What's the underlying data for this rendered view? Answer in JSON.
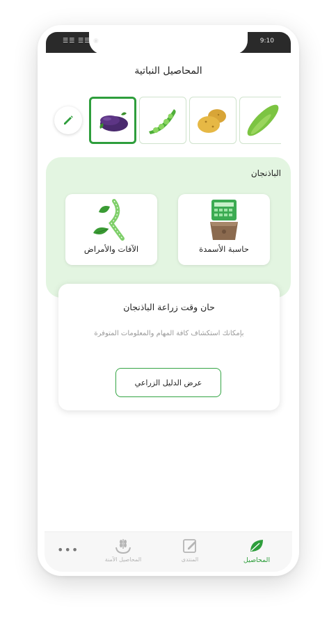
{
  "status_bar": {
    "left": "☰☰ ☰☰ ◉",
    "time": "9:10"
  },
  "page_title": "المحاصيل النباتية",
  "crops": [
    {
      "name": "cucumber-icon"
    },
    {
      "name": "potato-icon"
    },
    {
      "name": "peas-icon"
    },
    {
      "name": "eggplant-icon",
      "selected": true
    }
  ],
  "selected_crop": "الباذنجان",
  "tools": {
    "fertilizer_calculator": "حاسبة الأسمدة",
    "pests_diseases": "الآفات والأمراض"
  },
  "info_card": {
    "title": "حان وقت زراعة الباذنجان",
    "description": "بإمكانك استكشاف كافة المهام  والمعلومات المتوفرة",
    "guide_button": "عرض الدليل الزراعي"
  },
  "bottom_nav": {
    "crops": "المحاصيل",
    "forum": "المنتدى",
    "safe_crops": "المحاصيل الآمنة",
    "more": "•••"
  },
  "colors": {
    "primary": "#2e9e3c",
    "panel": "#e3f5e1"
  }
}
